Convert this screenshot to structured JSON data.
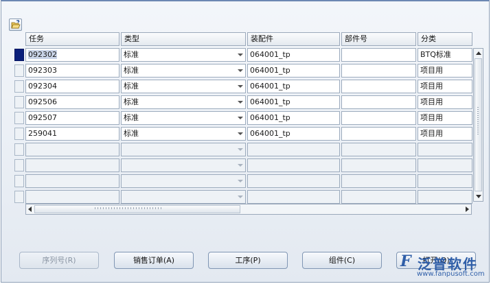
{
  "toolbar": {
    "open_icon": "folder-open-icon"
  },
  "columns": [
    "任务",
    "类型",
    "装配件",
    "部件号",
    "分类"
  ],
  "rows": [
    {
      "task": "092302",
      "type": "标准",
      "assembly": "064001_tp",
      "part": "",
      "category": "BTQ标准"
    },
    {
      "task": "092303",
      "type": "标准",
      "assembly": "064001_tp",
      "part": "",
      "category": "项目用"
    },
    {
      "task": "092304",
      "type": "标准",
      "assembly": "064001_tp",
      "part": "",
      "category": "项目用"
    },
    {
      "task": "092506",
      "type": "标准",
      "assembly": "064001_tp",
      "part": "",
      "category": "项目用"
    },
    {
      "task": "092507",
      "type": "标准",
      "assembly": "064001_tp",
      "part": "",
      "category": "项目用"
    },
    {
      "task": "259041",
      "type": "标准",
      "assembly": "064001_tp",
      "part": "",
      "category": "项目用"
    }
  ],
  "buttons": {
    "serial": "序列号(R)",
    "sales_order": "销售订单(A)",
    "operation": "工序(P)",
    "component": "组件(C)",
    "open": "打开(O)"
  },
  "watermark": {
    "brand": "泛普软件",
    "url": "www.fanpusoft.com"
  }
}
